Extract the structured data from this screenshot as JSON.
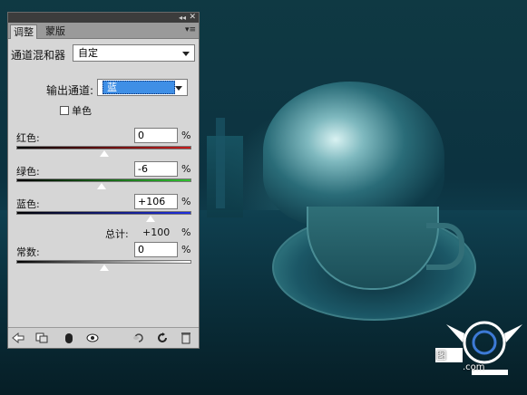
{
  "panel": {
    "title_controls": {
      "collapse": "◂◂",
      "close": "✕"
    },
    "tabs": [
      {
        "label": "调整",
        "active": true
      },
      {
        "label": "蒙版",
        "active": false
      }
    ],
    "menu_icon": "▾≡",
    "tool_name": "通道混和器",
    "preset": "自定",
    "output_channel_label": "输出通道:",
    "output_channel_value": "蓝",
    "monochrome_label": "单色",
    "monochrome_checked": false,
    "sliders": [
      {
        "label": "红色:",
        "value": "0",
        "unit": "%",
        "level": 0.5,
        "gradient": [
          "#000000",
          "#c81d1d"
        ]
      },
      {
        "label": "绿色:",
        "value": "-6",
        "unit": "%",
        "level": 0.485,
        "gradient": [
          "#000000",
          "#2fc12f"
        ]
      },
      {
        "label": "蓝色:",
        "value": "+106",
        "unit": "%",
        "level": 0.765,
        "gradient": [
          "#000000",
          "#1e2ee0"
        ]
      }
    ],
    "total_label": "总计:",
    "total_value": "+100",
    "total_unit": "%",
    "constant": {
      "label": "常数:",
      "value": "0",
      "unit": "%",
      "level": 0.5,
      "gradient": [
        "#000000",
        "#ffffff"
      ]
    },
    "footer_icons": [
      "arrow-left-icon",
      "clip-layer-icon",
      "visibility-mask-icon",
      "eye-icon",
      "previous-state-icon",
      "reset-icon",
      "trash-icon"
    ]
  },
  "watermark": {
    "text": "图",
    "url": ".com"
  },
  "colors": {
    "panel_bg": "#d6d6d6",
    "highlight": "#3f8fe6"
  }
}
